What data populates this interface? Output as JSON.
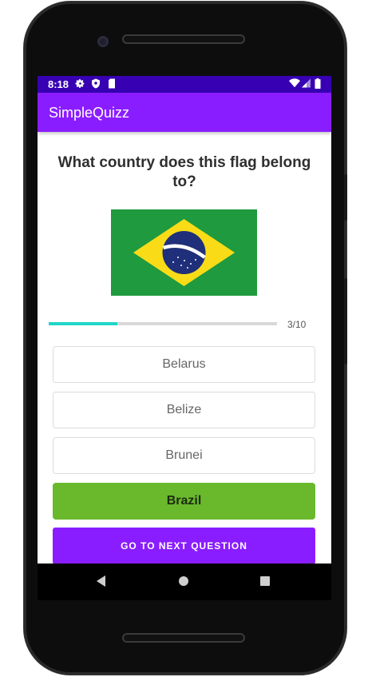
{
  "status_bar": {
    "time": "8:18",
    "left_icons": [
      "gear-icon",
      "shield-icon",
      "sd-card-icon"
    ],
    "right_icons": [
      "wifi-icon",
      "signal-icon",
      "battery-icon"
    ]
  },
  "app_bar": {
    "title": "SimpleQuizz",
    "color": "#8a1dff"
  },
  "quiz": {
    "question": "What country does this flag belong to?",
    "flag": "brazil-flag",
    "progress": {
      "current": 3,
      "total": 10,
      "fraction": 0.3,
      "label": "3/10"
    },
    "answers": [
      {
        "label": "Belarus",
        "state": "default"
      },
      {
        "label": "Belize",
        "state": "default"
      },
      {
        "label": "Brunei",
        "state": "default"
      },
      {
        "label": "Brazil",
        "state": "correct"
      }
    ],
    "next_button": "GO TO NEXT QUESTION"
  },
  "colors": {
    "status_bar": "#3700b3",
    "accent": "#8a1dff",
    "correct": "#6ab92d",
    "progress": "#1fd6c8"
  },
  "nav_bar": {
    "icons": [
      "back-icon",
      "home-icon",
      "recents-icon"
    ]
  }
}
